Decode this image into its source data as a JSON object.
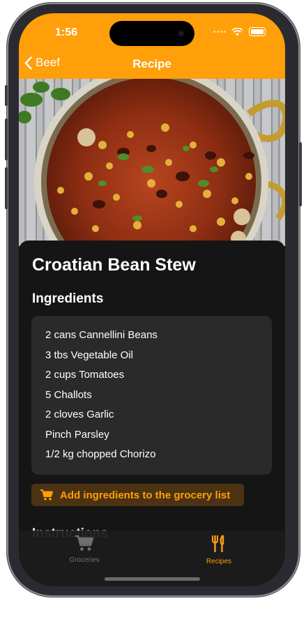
{
  "status_bar": {
    "time": "1:56"
  },
  "nav": {
    "back_label": "Beef",
    "title": "Recipe"
  },
  "recipe": {
    "title": "Croatian Bean Stew",
    "ingredients_heading": "Ingredients",
    "ingredients": [
      "2 cans Cannellini Beans",
      "3 tbs Vegetable Oil",
      "2 cups  Tomatoes",
      "5 Challots",
      "2 cloves Garlic",
      "Pinch Parsley",
      "1/2 kg chopped  Chorizo"
    ],
    "add_to_grocery_label": "Add ingredients to the grocery list",
    "instructions_heading": "Instructions"
  },
  "tabbar": {
    "items": [
      {
        "label": "Groceries",
        "icon": "cart-icon",
        "selected": false
      },
      {
        "label": "Recipes",
        "icon": "fork-knife-icon",
        "selected": true
      }
    ]
  },
  "colors": {
    "accent": "#ff9f0a",
    "background": "#111111",
    "card": "#2a2a2a"
  }
}
